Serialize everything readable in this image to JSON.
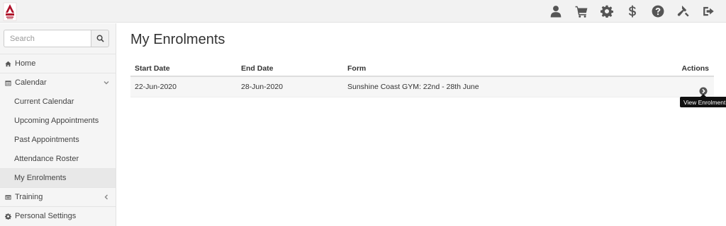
{
  "topbar": {
    "icons": [
      "user-icon",
      "cart-icon",
      "gear-icon",
      "dollar-icon",
      "help-icon",
      "gavel-icon",
      "sign-out-icon"
    ]
  },
  "sidebar": {
    "search": {
      "placeholder": "Search",
      "value": ""
    },
    "items": [
      {
        "label": "Home",
        "icon": "home-icon"
      },
      {
        "label": "Calendar",
        "icon": "calendar-icon",
        "expanded": true,
        "children": [
          {
            "label": "Current Calendar"
          },
          {
            "label": "Upcoming Appointments"
          },
          {
            "label": "Past Appointments"
          },
          {
            "label": "Attendance Roster"
          },
          {
            "label": "My Enrolments",
            "active": true
          }
        ]
      },
      {
        "label": "Training",
        "icon": "list-icon",
        "expanded": false
      },
      {
        "label": "Personal Settings",
        "icon": "gear-icon"
      }
    ]
  },
  "main": {
    "title": "My Enrolments",
    "table": {
      "headers": [
        "Start Date",
        "End Date",
        "Form",
        "Actions"
      ],
      "rows": [
        {
          "start": "22-Jun-2020",
          "end": "28-Jun-2020",
          "form": "Sunshine Coast GYM: 22nd - 28th June"
        }
      ]
    },
    "tooltip": "View Enrolment"
  },
  "colors": {
    "accent": "#b0122b",
    "topbar_bg": "#f2f2f2",
    "sidebar_bg": "#f5f5f5",
    "row_bg": "#f6f6f6"
  }
}
